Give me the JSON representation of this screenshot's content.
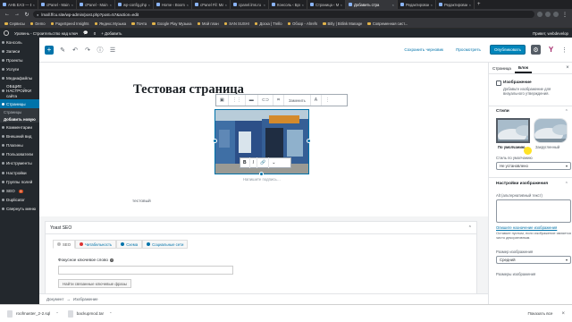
{
  "browser": {
    "tabs": [
      {
        "label": "АНБ ЕАЭ — Ех",
        "active": false
      },
      {
        "label": "cPanel - Main",
        "active": false
      },
      {
        "label": "cPanel - Main",
        "active": false
      },
      {
        "label": "wp-config.php",
        "active": false
      },
      {
        "label": "Home ‹ Boom",
        "active": false
      },
      {
        "label": "cPanel Fil: Ma",
        "active": false
      },
      {
        "label": "cpanel.lms.ru",
        "active": false
      },
      {
        "label": "Консоль ‹ Бро",
        "active": false
      },
      {
        "label": "Страница ‹ Ma",
        "active": false
      },
      {
        "label": "Добавить стра",
        "active": true
      },
      {
        "label": "Редактирован",
        "active": false
      },
      {
        "label": "Редактирован",
        "active": false
      }
    ],
    "url": "lmall.ffcu.site/wp-admin/post.php?post=57&action=edit",
    "bookmarks": [
      "Сервисы",
      "Demo",
      "PageSpeed Insights",
      "Яндекс.Музыка",
      "Почта",
      "Google Play Музыка",
      "Мой план",
      "SAN SUSHI",
      "Доска | Trello",
      "Обзор - Ahrefs",
      "Bitly | Bitlink Manage",
      "Современная сист..."
    ]
  },
  "adminbar": {
    "site": "Уровень - Строительство над ключ",
    "comments": "0",
    "new": "+ Добавить",
    "greeting": "Привет, webdevelop"
  },
  "sidebar": {
    "items": [
      {
        "label": "Консоль"
      },
      {
        "label": "Записи"
      },
      {
        "label": "Проекты"
      },
      {
        "label": "Услуги"
      },
      {
        "label": "Медиафайлы"
      },
      {
        "label": "ОБЩИЕ НАСТРОЙКИ сайта"
      },
      {
        "label": "Страницы"
      }
    ],
    "subitems": [
      "Страницы",
      "Добавить новую"
    ],
    "items2": [
      {
        "label": "Комментарии"
      },
      {
        "label": "Внешний вид"
      },
      {
        "label": "Плагины"
      },
      {
        "label": "Пользователи"
      },
      {
        "label": "Инструменты"
      },
      {
        "label": "Настройки"
      },
      {
        "label": "Группы полей"
      },
      {
        "label": "SEO",
        "badge": "1"
      },
      {
        "label": "Duplicator"
      },
      {
        "label": "Свернуть меню"
      }
    ]
  },
  "toolbar": {
    "add_block": "+",
    "save_draft": "Сохранить черновик",
    "preview": "Просмотреть",
    "publish": "Опубликовать",
    "yoast": "Y"
  },
  "editor": {
    "title": "Тестовая страница",
    "replace_label": "Заменить",
    "text_label": "A",
    "caption_placeholder": "Напишите подпись…",
    "inline_buttons": [
      "B",
      "I",
      "🔗",
      "⌄"
    ],
    "paragraph": "тестовый"
  },
  "yoast": {
    "title": "Yoast SEO",
    "tabs": [
      {
        "label": "SEO",
        "color": "#bbbbbb"
      },
      {
        "label": "Читабельность",
        "color": "#dc3232"
      },
      {
        "label": "Схема",
        "color": "#0073aa"
      },
      {
        "label": "Социальные сети",
        "color": "#0073aa"
      }
    ],
    "focus_label": "Фокусное ключевое слово",
    "related_button": "Найти связанные ключевые фразы"
  },
  "breadcrumbs": [
    "Документ",
    "→",
    "Изображение"
  ],
  "settings": {
    "tabs": [
      "Страница",
      "Блок"
    ],
    "block_name": "Изображение",
    "block_desc": "Добавьте изображение для визуального утверждения.",
    "styles_title": "Стили",
    "style_default": "По умолчанию",
    "style_rounded": "Закругленный",
    "default_style_label": "Стиль по умолчанию",
    "default_style_value": "Не установлено",
    "image_settings_title": "Настройки изображения",
    "alt_label": "Alt (альтернативный текст)",
    "alt_link": "Опишите назначение изображения",
    "alt_help": "Оставьте пустым, если изображение является чисто декоративным.",
    "size_label": "Размер изображения",
    "size_value": "Средний",
    "dims_label": "Размеры изображения"
  },
  "downloads": {
    "files": [
      "roofmaster_2-2.sql",
      "backupmod.tar"
    ],
    "show_all": "Показать все"
  },
  "colors": {
    "accent": "#0073aa",
    "publish": "#0085ba",
    "sidebar_bg": "#23282d"
  }
}
